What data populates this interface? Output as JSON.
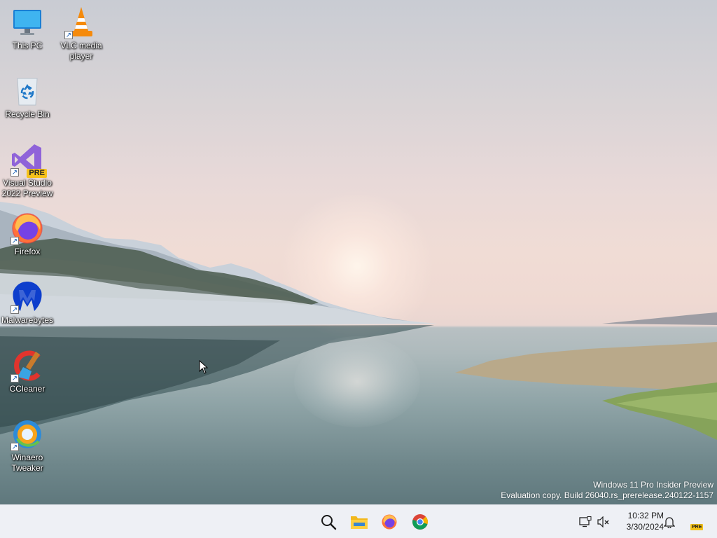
{
  "desktop": {
    "icons": [
      {
        "id": "this-pc",
        "label": "This PC"
      },
      {
        "id": "vlc",
        "label": "VLC media player"
      },
      {
        "id": "recycle-bin",
        "label": "Recycle Bin"
      },
      {
        "id": "visual-studio",
        "label": "Visual Studio 2022 Preview",
        "badge": "PRE"
      },
      {
        "id": "firefox",
        "label": "Firefox"
      },
      {
        "id": "malwarebytes",
        "label": "Malwarebytes"
      },
      {
        "id": "ccleaner",
        "label": "CCleaner"
      },
      {
        "id": "winaero",
        "label": "Winaero Tweaker"
      }
    ],
    "watermark": {
      "line1": "Windows 11 Pro Insider Preview",
      "line2": "Evaluation copy. Build 26040.rs_prerelease.240122-1157"
    }
  },
  "taskbar": {
    "pinned": [
      {
        "icon": "search-icon"
      },
      {
        "icon": "file-explorer-icon"
      },
      {
        "icon": "firefox-icon"
      },
      {
        "icon": "chrome-icon"
      }
    ],
    "tray": {
      "icons": [
        "network-icon",
        "volume-muted-icon"
      ],
      "time": "10:32 PM",
      "date": "3/30/2024",
      "notification_icon": "bell-icon",
      "pre_badge": "PRE"
    }
  },
  "colors": {
    "taskbar_bg": "#eef0f5",
    "accent": "#0067c0"
  }
}
